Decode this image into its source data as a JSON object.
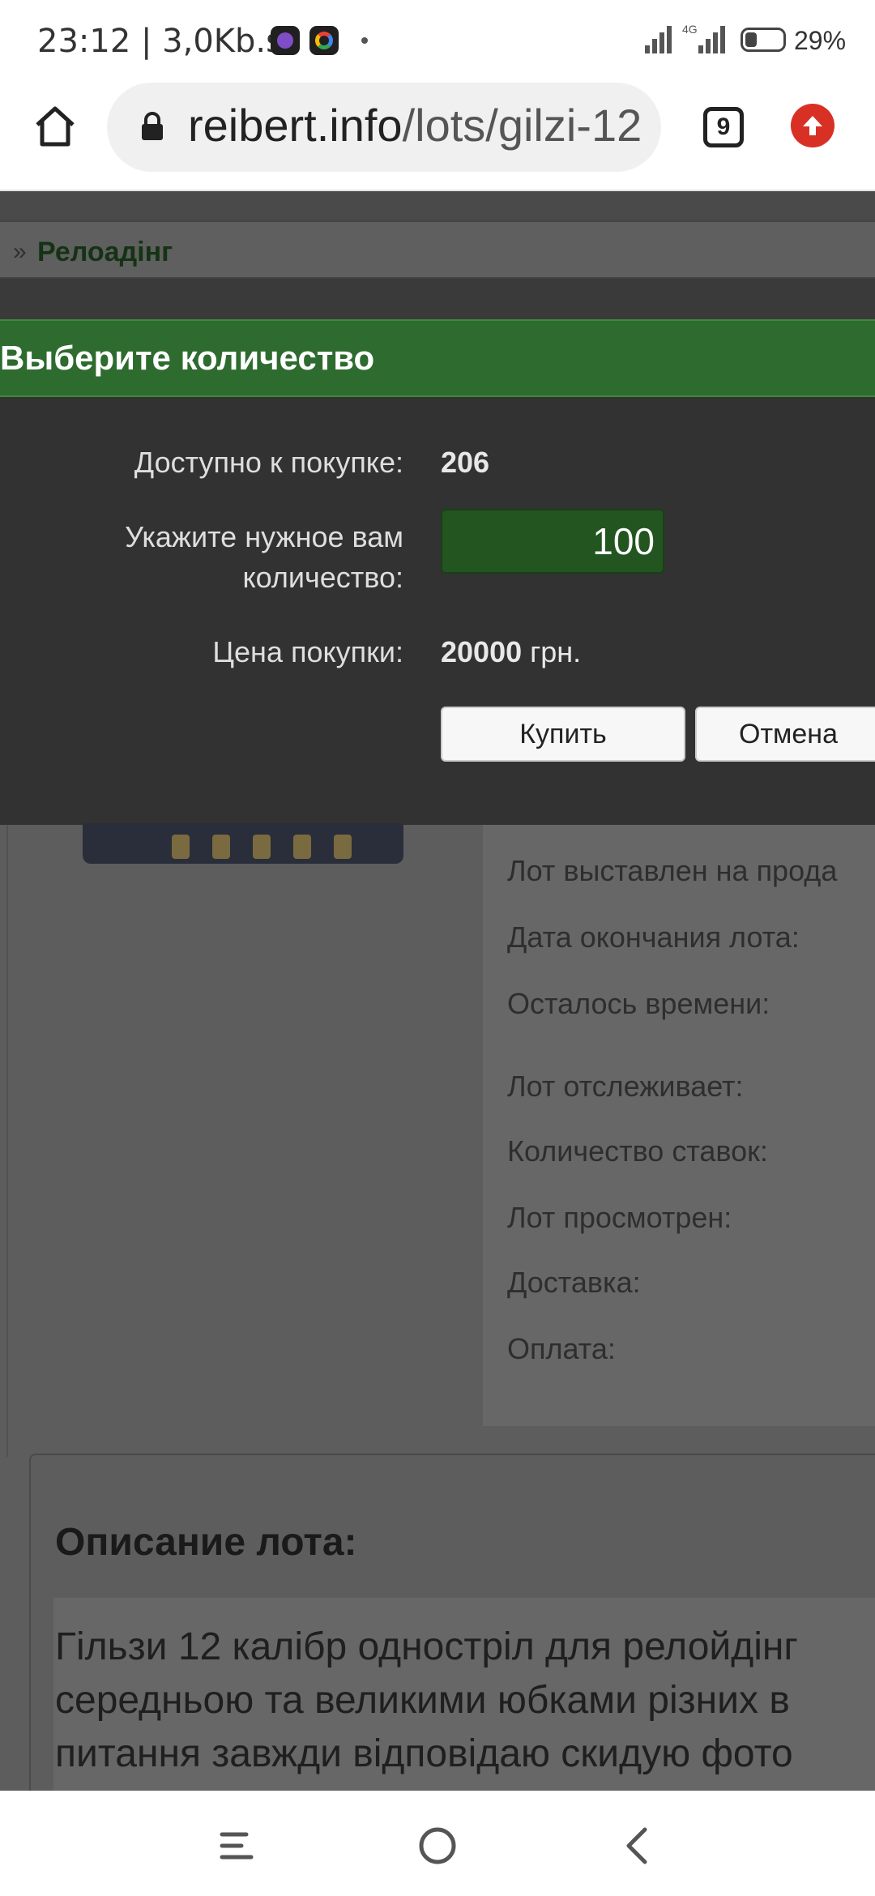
{
  "status_bar": {
    "time_speed": "23:12 | 3,0Kb.s",
    "network_label": "4G",
    "battery": "29%"
  },
  "browser": {
    "url_host": "reibert.info",
    "url_path": "/lots/gilzi-12",
    "tab_count": "9"
  },
  "breadcrumb": {
    "separator": "»",
    "current": "Релоадінг"
  },
  "dialog": {
    "title": "Выберите количество",
    "available_label": "Доступно к покупке:",
    "available_value": "206",
    "quantity_label_line1": "Укажите нужное вам",
    "quantity_label_line2": "количество:",
    "quantity_value": "100",
    "price_label": "Цена покупки:",
    "price_value": "20000",
    "price_currency": "грн.",
    "buy_button": "Купить",
    "cancel_button": "Отмена"
  },
  "lot_info": {
    "labels": [
      "Лот выставлен на прода",
      "Дата окончания лота:",
      "Осталось времени:",
      "Лот отслеживает:",
      "Количество ставок:",
      "Лот просмотрен:",
      "Доставка:",
      "Оплата:"
    ]
  },
  "description": {
    "title": "Описание лота:",
    "lines": [
      "Гільзи 12 калібр одностріл для релойдінг",
      "середньою та великими юбками різних в",
      "питання завжди відповідаю скидую фото"
    ]
  }
}
